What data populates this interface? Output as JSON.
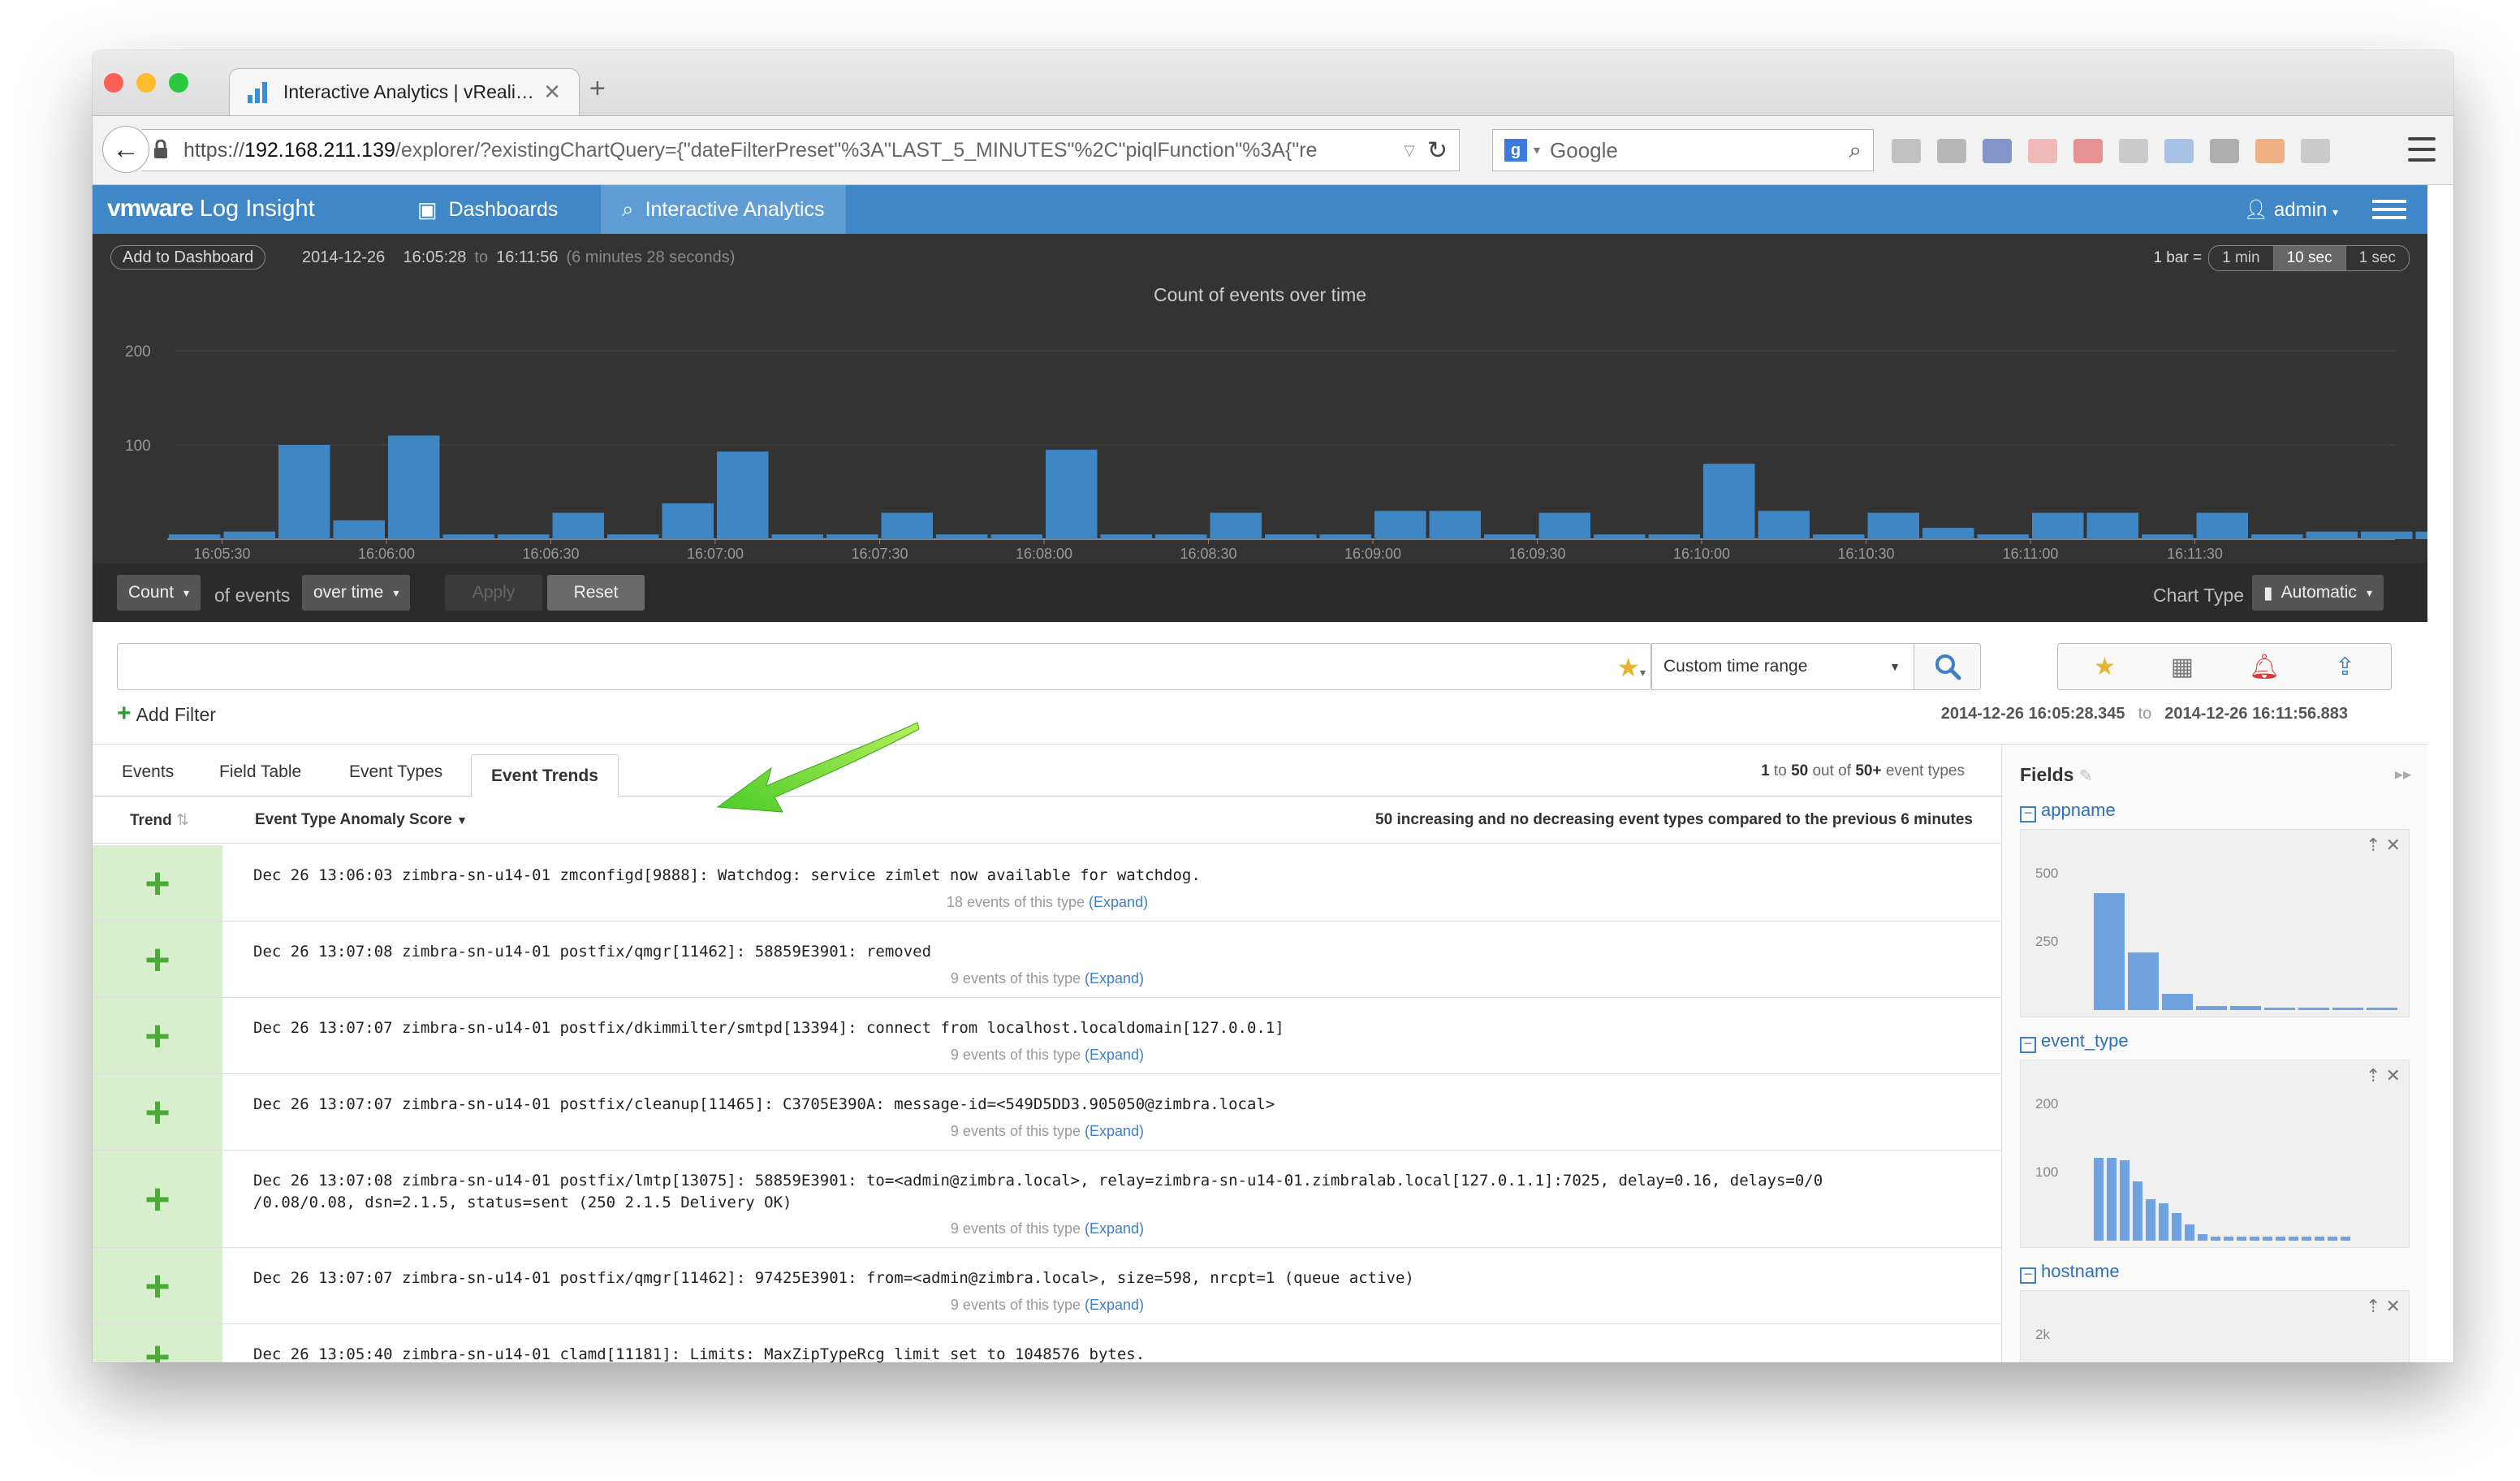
{
  "browser": {
    "tab_title": "Interactive Analytics | vReali…",
    "url_prefix": "https://",
    "url_host": "192.168.211.139",
    "url_tail": "/explorer/?existingChartQuery={\"dateFilterPreset\"%3A\"LAST_5_MINUTES\"%2C\"piqlFunction\"%3A{\"re",
    "search_engine": "Google",
    "search_placeholder": "Google"
  },
  "app": {
    "logo_brand": "vmware",
    "logo_product": "Log Insight",
    "nav": [
      {
        "label": "Dashboards",
        "icon": "dashboard-icon"
      },
      {
        "label": "Interactive Analytics",
        "icon": "search-icon"
      }
    ],
    "user": "admin",
    "accent": "#3f87c7"
  },
  "chart_header": {
    "add_to_dashboard": "Add to Dashboard",
    "date": "2014-12-26",
    "start_time": "16:05:28",
    "to": "to",
    "end_time": "16:11:56",
    "duration": "(6 minutes 28 seconds)",
    "bar_label": "1 bar =",
    "bar_options": [
      "1 min",
      "10 sec",
      "1 sec"
    ],
    "bar_selected": "10 sec"
  },
  "chart_data": {
    "type": "bar",
    "title": "Count of events over time",
    "xlabel": "",
    "ylabel": "",
    "ylim": [
      0,
      200
    ],
    "yticks": [
      100,
      200
    ],
    "x_tick_labels": [
      "16:05:30",
      "16:06:00",
      "16:06:30",
      "16:07:00",
      "16:07:30",
      "16:08:00",
      "16:08:30",
      "16:09:00",
      "16:09:30",
      "16:10:00",
      "16:10:30",
      "16:11:00",
      "16:11:30"
    ],
    "bar_interval_seconds": 10,
    "first_bar_time": "16:05:20",
    "values": [
      5,
      8,
      100,
      20,
      110,
      5,
      5,
      28,
      5,
      38,
      93,
      5,
      5,
      28,
      5,
      5,
      95,
      5,
      5,
      28,
      5,
      5,
      30,
      30,
      5,
      28,
      5,
      5,
      80,
      30,
      5,
      28,
      12,
      5,
      28,
      28,
      5,
      28,
      5,
      8,
      8,
      8
    ],
    "color": "#3f86c4"
  },
  "controls": {
    "aggregate": "Count",
    "of_events": "of events",
    "grouping": "over time",
    "apply": "Apply",
    "reset": "Reset",
    "chart_type_label": "Chart Type",
    "chart_type": "Automatic"
  },
  "query": {
    "value": "",
    "time_range": "Custom time range",
    "add_filter": "Add Filter",
    "range_start": "2014-12-26 16:05:28.345",
    "range_to": "to",
    "range_end": "2014-12-26 16:11:56.883"
  },
  "results": {
    "tabs": [
      "Events",
      "Field Table",
      "Event Types",
      "Event Trends"
    ],
    "active_tab": "Event Trends",
    "count_from": "1",
    "count_to_word": "to",
    "count_to": "50",
    "count_out_of": "out of",
    "count_total": "50+",
    "count_suffix": "event types",
    "col_trend": "Trend",
    "col_score": "Event Type Anomaly Score",
    "summary": "50 increasing and no decreasing event types compared to the previous 6 minutes",
    "expand": "(Expand)",
    "rows": [
      {
        "trend": "+",
        "message": "Dec 26 13:06:03 zimbra-sn-u14-01 zmconfigd[9888]: Watchdog: service zimlet now available for watchdog.",
        "count": "18 events of this type"
      },
      {
        "trend": "+",
        "message": "Dec 26 13:07:08 zimbra-sn-u14-01 postfix/qmgr[11462]: 58859E3901: removed",
        "count": "9 events of this type"
      },
      {
        "trend": "+",
        "message": "Dec 26 13:07:07 zimbra-sn-u14-01 postfix/dkimmilter/smtpd[13394]: connect from localhost.localdomain[127.0.0.1]",
        "count": "9 events of this type"
      },
      {
        "trend": "+",
        "message": "Dec 26 13:07:07 zimbra-sn-u14-01 postfix/cleanup[11465]: C3705E390A: message-id=<549D5DD3.905050@zimbra.local>",
        "count": "9 events of this type"
      },
      {
        "trend": "+",
        "message": "Dec 26 13:07:08 zimbra-sn-u14-01 postfix/lmtp[13075]: 58859E3901: to=<admin@zimbra.local>, relay=zimbra-sn-u14-01.zimbralab.local[127.0.1.1]:7025, delay=0.16, delays=0/0\n/0.08/0.08, dsn=2.1.5, status=sent (250 2.1.5 Delivery OK)",
        "count": "9 events of this type"
      },
      {
        "trend": "+",
        "message": "Dec 26 13:07:07 zimbra-sn-u14-01 postfix/qmgr[11462]: 97425E3901: from=<admin@zimbra.local>, size=598, nrcpt=1 (queue active)",
        "count": "9 events of this type"
      },
      {
        "trend": "+",
        "message": "Dec 26 13:05:40 zimbra-sn-u14-01 clamd[11181]: Limits: MaxZipTypeRcg limit set to 1048576 bytes.",
        "count": ""
      }
    ]
  },
  "fields": {
    "title": "Fields",
    "items": [
      {
        "name": "appname",
        "ticks": [
          "500",
          "250"
        ],
        "values": [
          0.85,
          0.42,
          0.12,
          0.03,
          0.03,
          0.02,
          0.02,
          0.02,
          0.02
        ]
      },
      {
        "name": "event_type",
        "ticks": [
          "200",
          "100"
        ],
        "values": [
          0.6,
          0.6,
          0.58,
          0.43,
          0.3,
          0.27,
          0.2,
          0.12,
          0.05,
          0.03,
          0.03,
          0.03,
          0.03,
          0.03,
          0.03,
          0.03,
          0.03,
          0.03,
          0.03,
          0.03
        ]
      },
      {
        "name": "hostname",
        "ticks": [
          "2k"
        ],
        "values": []
      }
    ]
  }
}
